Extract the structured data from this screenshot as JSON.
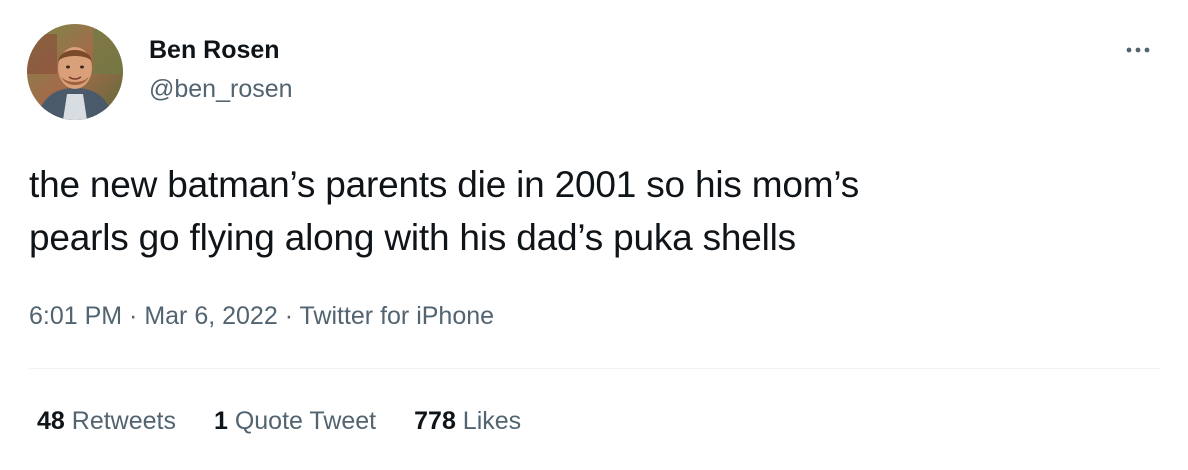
{
  "author": {
    "display_name": "Ben Rosen",
    "handle": "@ben_rosen"
  },
  "tweet": {
    "text_line1": "the new batman’s parents die in 2001 so his mom’s",
    "text_line2": "pearls go flying along with his dad’s puka shells"
  },
  "meta": {
    "time": "6:01 PM",
    "separator": " · ",
    "date": "Mar 6, 2022",
    "source": "Twitter for iPhone"
  },
  "stats": {
    "retweets_count": "48",
    "retweets_label": " Retweets",
    "quotes_count": "1",
    "quotes_label": " Quote Tweet",
    "likes_count": "778",
    "likes_label": " Likes"
  },
  "icons": {
    "more": "more-horizontal-icon"
  },
  "colors": {
    "primary_text": "#0f1419",
    "secondary_text": "#536471",
    "divider": "#eff3f4"
  }
}
